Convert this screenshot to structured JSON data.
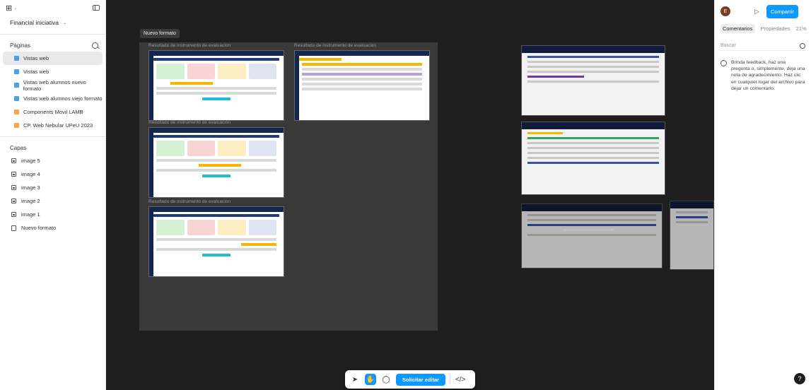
{
  "app": {
    "logo": "⊞"
  },
  "file": {
    "name": "Financial iniciativa"
  },
  "pages": {
    "header": "Páginas",
    "items": [
      {
        "label": "Vistas web",
        "color": "#4aa3df",
        "active": true
      },
      {
        "label": "Vistas web",
        "color": "#4aa3df",
        "active": false
      },
      {
        "label": "Vistas web alumnos nuevo formato",
        "color": "#4aa3df",
        "active": false
      },
      {
        "label": "Vistas web alumnos viejo formato",
        "color": "#4aa3df",
        "active": false
      },
      {
        "label": "Components Movil LAMB",
        "color": "#f2a94a",
        "active": false
      },
      {
        "label": "CP. Web Nebular UPeU 2023",
        "color": "#f2a94a",
        "active": false
      }
    ]
  },
  "layers": {
    "header": "Capas",
    "items": [
      {
        "label": "image 5",
        "type": "image"
      },
      {
        "label": "image 4",
        "type": "image"
      },
      {
        "label": "image 3",
        "type": "image"
      },
      {
        "label": "image 2",
        "type": "image"
      },
      {
        "label": "image 1",
        "type": "image"
      },
      {
        "label": "Nuevo formato",
        "type": "frame"
      }
    ]
  },
  "canvas": {
    "frame_label": "Nuevo formato",
    "sublabels": [
      "Resultado de instrumento de evaluacion",
      "Resultado de instrumento de evaluacion",
      "Resultado de instrumento de evaluacion",
      "Resultado de instrumento de evaluacion"
    ]
  },
  "toolbar": {
    "request_edit": "Solicitar editar"
  },
  "right": {
    "avatar": "E",
    "share": "Compartir",
    "tabs": [
      "Comentarios",
      "Propiedades"
    ],
    "zoom": "21%",
    "search_placeholder": "Buscar",
    "hint": "Brinda feedback, haz una pregunta o, simplemente, deja una nota de agradecimiento. Haz clic en cualquier lugar del archivo para dejar un comentario.",
    "help": "?"
  }
}
